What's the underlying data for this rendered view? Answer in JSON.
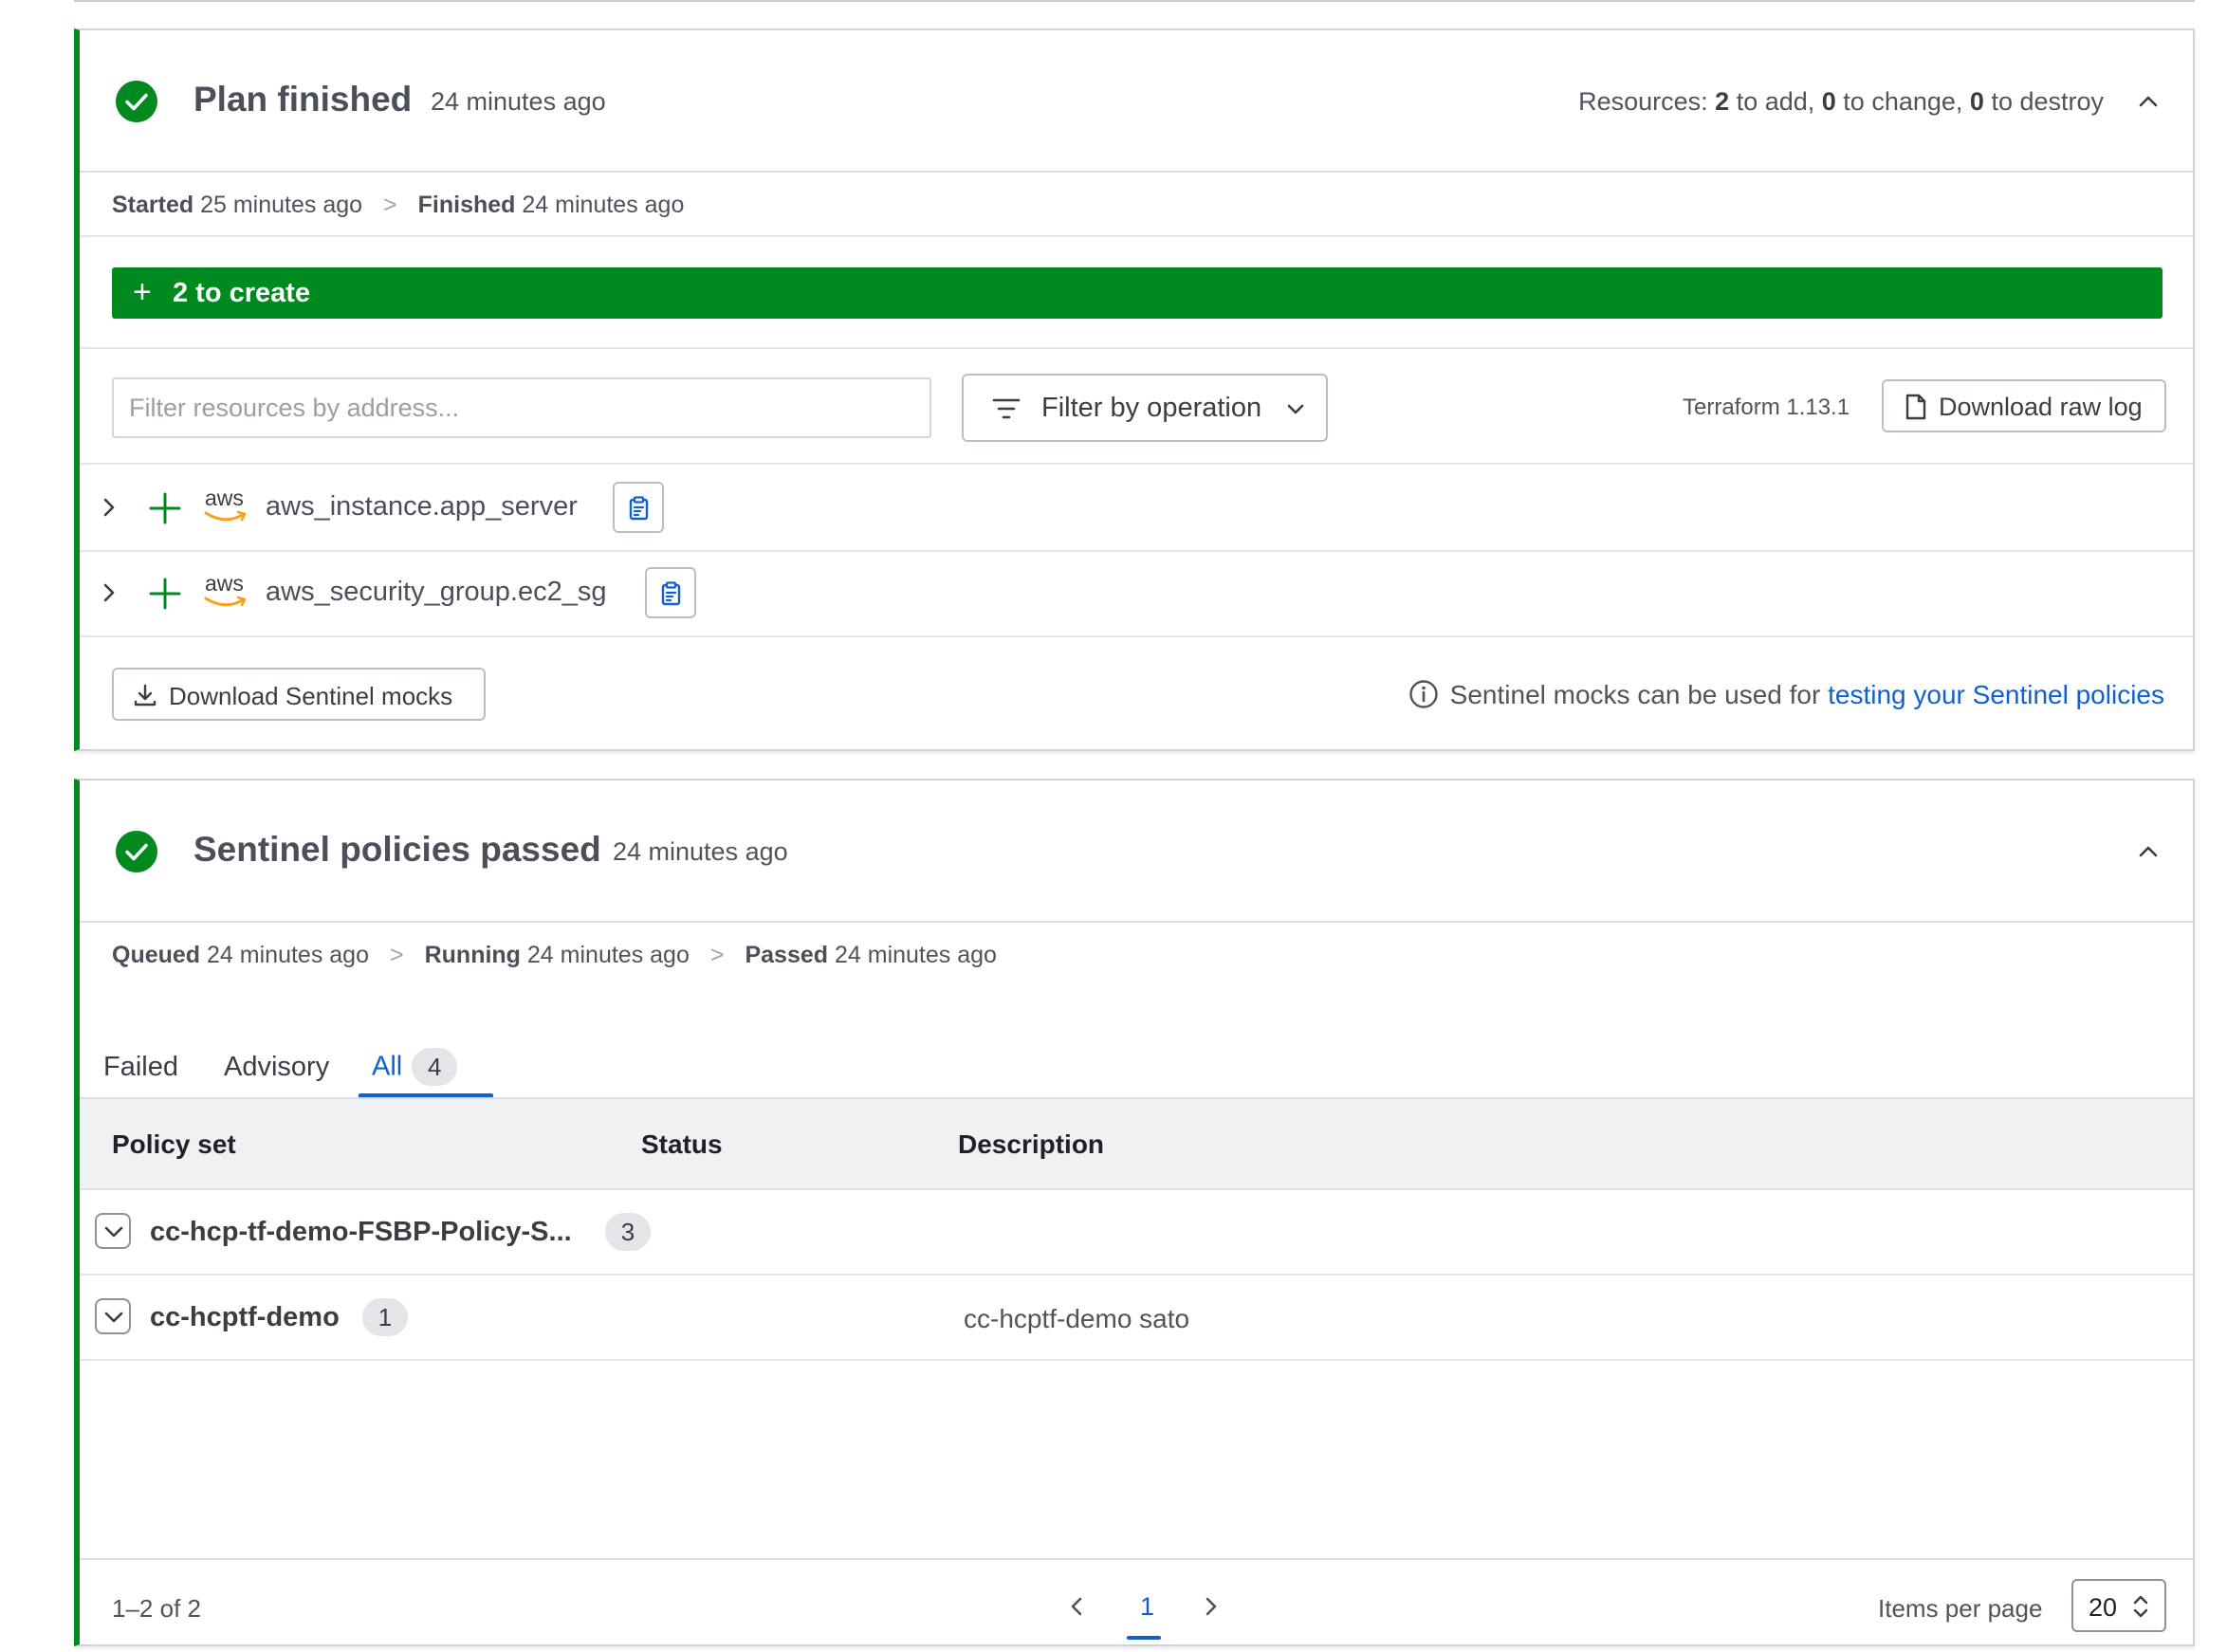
{
  "plan": {
    "title": "Plan finished",
    "time_ago": "24 minutes ago",
    "resources_prefix": "Resources: ",
    "add_count": "2",
    "add_text": " to add, ",
    "change_count": "0",
    "change_text": " to change, ",
    "destroy_count": "0",
    "destroy_text": " to destroy",
    "started_label": "Started",
    "started_value": "25 minutes ago",
    "finished_label": "Finished",
    "finished_value": "24 minutes ago",
    "create_plus": "+",
    "create_label": "2 to create",
    "filter_placeholder": "Filter resources by address...",
    "filter_op_label": "Filter by operation",
    "terraform_version": "Terraform 1.13.1",
    "download_raw_label": "Download raw log",
    "resources": [
      {
        "provider": "aws",
        "address": "aws_instance.app_server"
      },
      {
        "provider": "aws",
        "address": "aws_security_group.ec2_sg"
      }
    ],
    "mocks_button": "Download Sentinel mocks",
    "mocks_info_text": "Sentinel mocks can be used for ",
    "mocks_info_link": "testing your Sentinel policies"
  },
  "policy": {
    "title": "Sentinel policies passed",
    "time_ago": "24 minutes ago",
    "queued_label": "Queued",
    "queued_value": "24 minutes ago",
    "running_label": "Running",
    "running_value": "24 minutes ago",
    "passed_label": "Passed",
    "passed_value": "24 minutes ago",
    "tabs": [
      {
        "label": "Failed"
      },
      {
        "label": "Advisory"
      },
      {
        "label": "All",
        "count": "4",
        "active": true
      }
    ],
    "columns": [
      "Policy set",
      "Status",
      "Description"
    ],
    "rows": [
      {
        "name": "cc-hcp-tf-demo-FSBP-Policy-S...",
        "count": "3",
        "description": ""
      },
      {
        "name": "cc-hcptf-demo",
        "count": "1",
        "description": "cc-hcptf-demo sato"
      }
    ],
    "pagination": {
      "range": "1–2 of 2",
      "current_page": "1",
      "items_per_page_label": "Items per page",
      "items_per_page": "20"
    }
  },
  "colors": {
    "success": "#00891f",
    "link": "#1060d4",
    "aws_orange": "#f7a11a"
  }
}
